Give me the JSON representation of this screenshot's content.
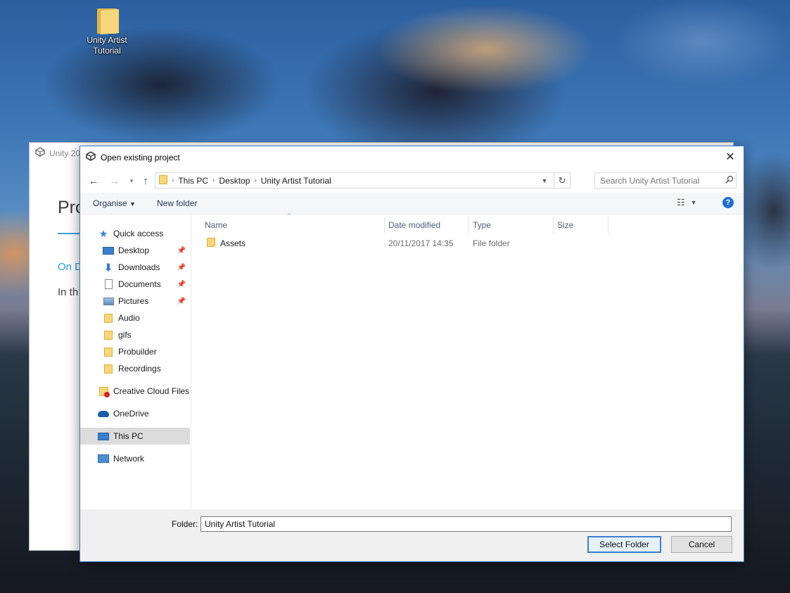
{
  "desktop": {
    "icon_label_line1": "Unity Artist",
    "icon_label_line2": "Tutorial"
  },
  "bg_window": {
    "title": "Unity 20",
    "heading": "Pro",
    "link": "On D",
    "text": "In th"
  },
  "dialog": {
    "title": "Open existing project",
    "address": {
      "seg1": "This PC",
      "seg2": "Desktop",
      "seg3": "Unity Artist Tutorial"
    },
    "search_placeholder": "Search Unity Artist Tutorial",
    "toolbar": {
      "organise": "Organise",
      "new_folder": "New folder"
    },
    "nav": {
      "quick_access": "Quick access",
      "items": [
        "Desktop",
        "Downloads",
        "Documents",
        "Pictures",
        "Audio",
        "gifs",
        "Probuilder",
        "Recordings"
      ],
      "creative_cloud": "Creative Cloud Files",
      "onedrive": "OneDrive",
      "this_pc": "This PC",
      "network": "Network"
    },
    "columns": {
      "name": "Name",
      "date": "Date modified",
      "type": "Type",
      "size": "Size"
    },
    "files": [
      {
        "name": "Assets",
        "date": "20/11/2017 14:35",
        "type": "File folder",
        "size": ""
      }
    ],
    "footer": {
      "folder_label": "Folder:",
      "folder_value": "Unity Artist Tutorial",
      "select_button": "Select Folder",
      "cancel_button": "Cancel"
    }
  },
  "colors": {
    "accent": "#3c7fd1",
    "folder": "#f7d77a",
    "selected_nav": "#dcdcdc",
    "help": "#1f6fd0"
  }
}
